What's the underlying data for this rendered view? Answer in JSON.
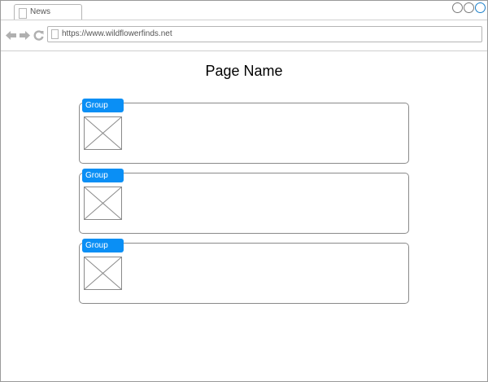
{
  "browser": {
    "tab_label": "News",
    "url": "https://www.wildflowerfinds.net",
    "window_controls": [
      "minimize",
      "maximize",
      "close"
    ],
    "nav_icons": [
      "back-arrow-icon",
      "forward-arrow-icon",
      "refresh-icon"
    ]
  },
  "page": {
    "title": "Page Name"
  },
  "groups": [
    {
      "label": "Group",
      "image": "image-placeholder-icon"
    },
    {
      "label": "Group",
      "image": "image-placeholder-icon"
    },
    {
      "label": "Group",
      "image": "image-placeholder-icon"
    }
  ],
  "colors": {
    "group_header": "#0a8ff5",
    "group_header_text": "#ffffff",
    "border": "#8a8a8a"
  }
}
